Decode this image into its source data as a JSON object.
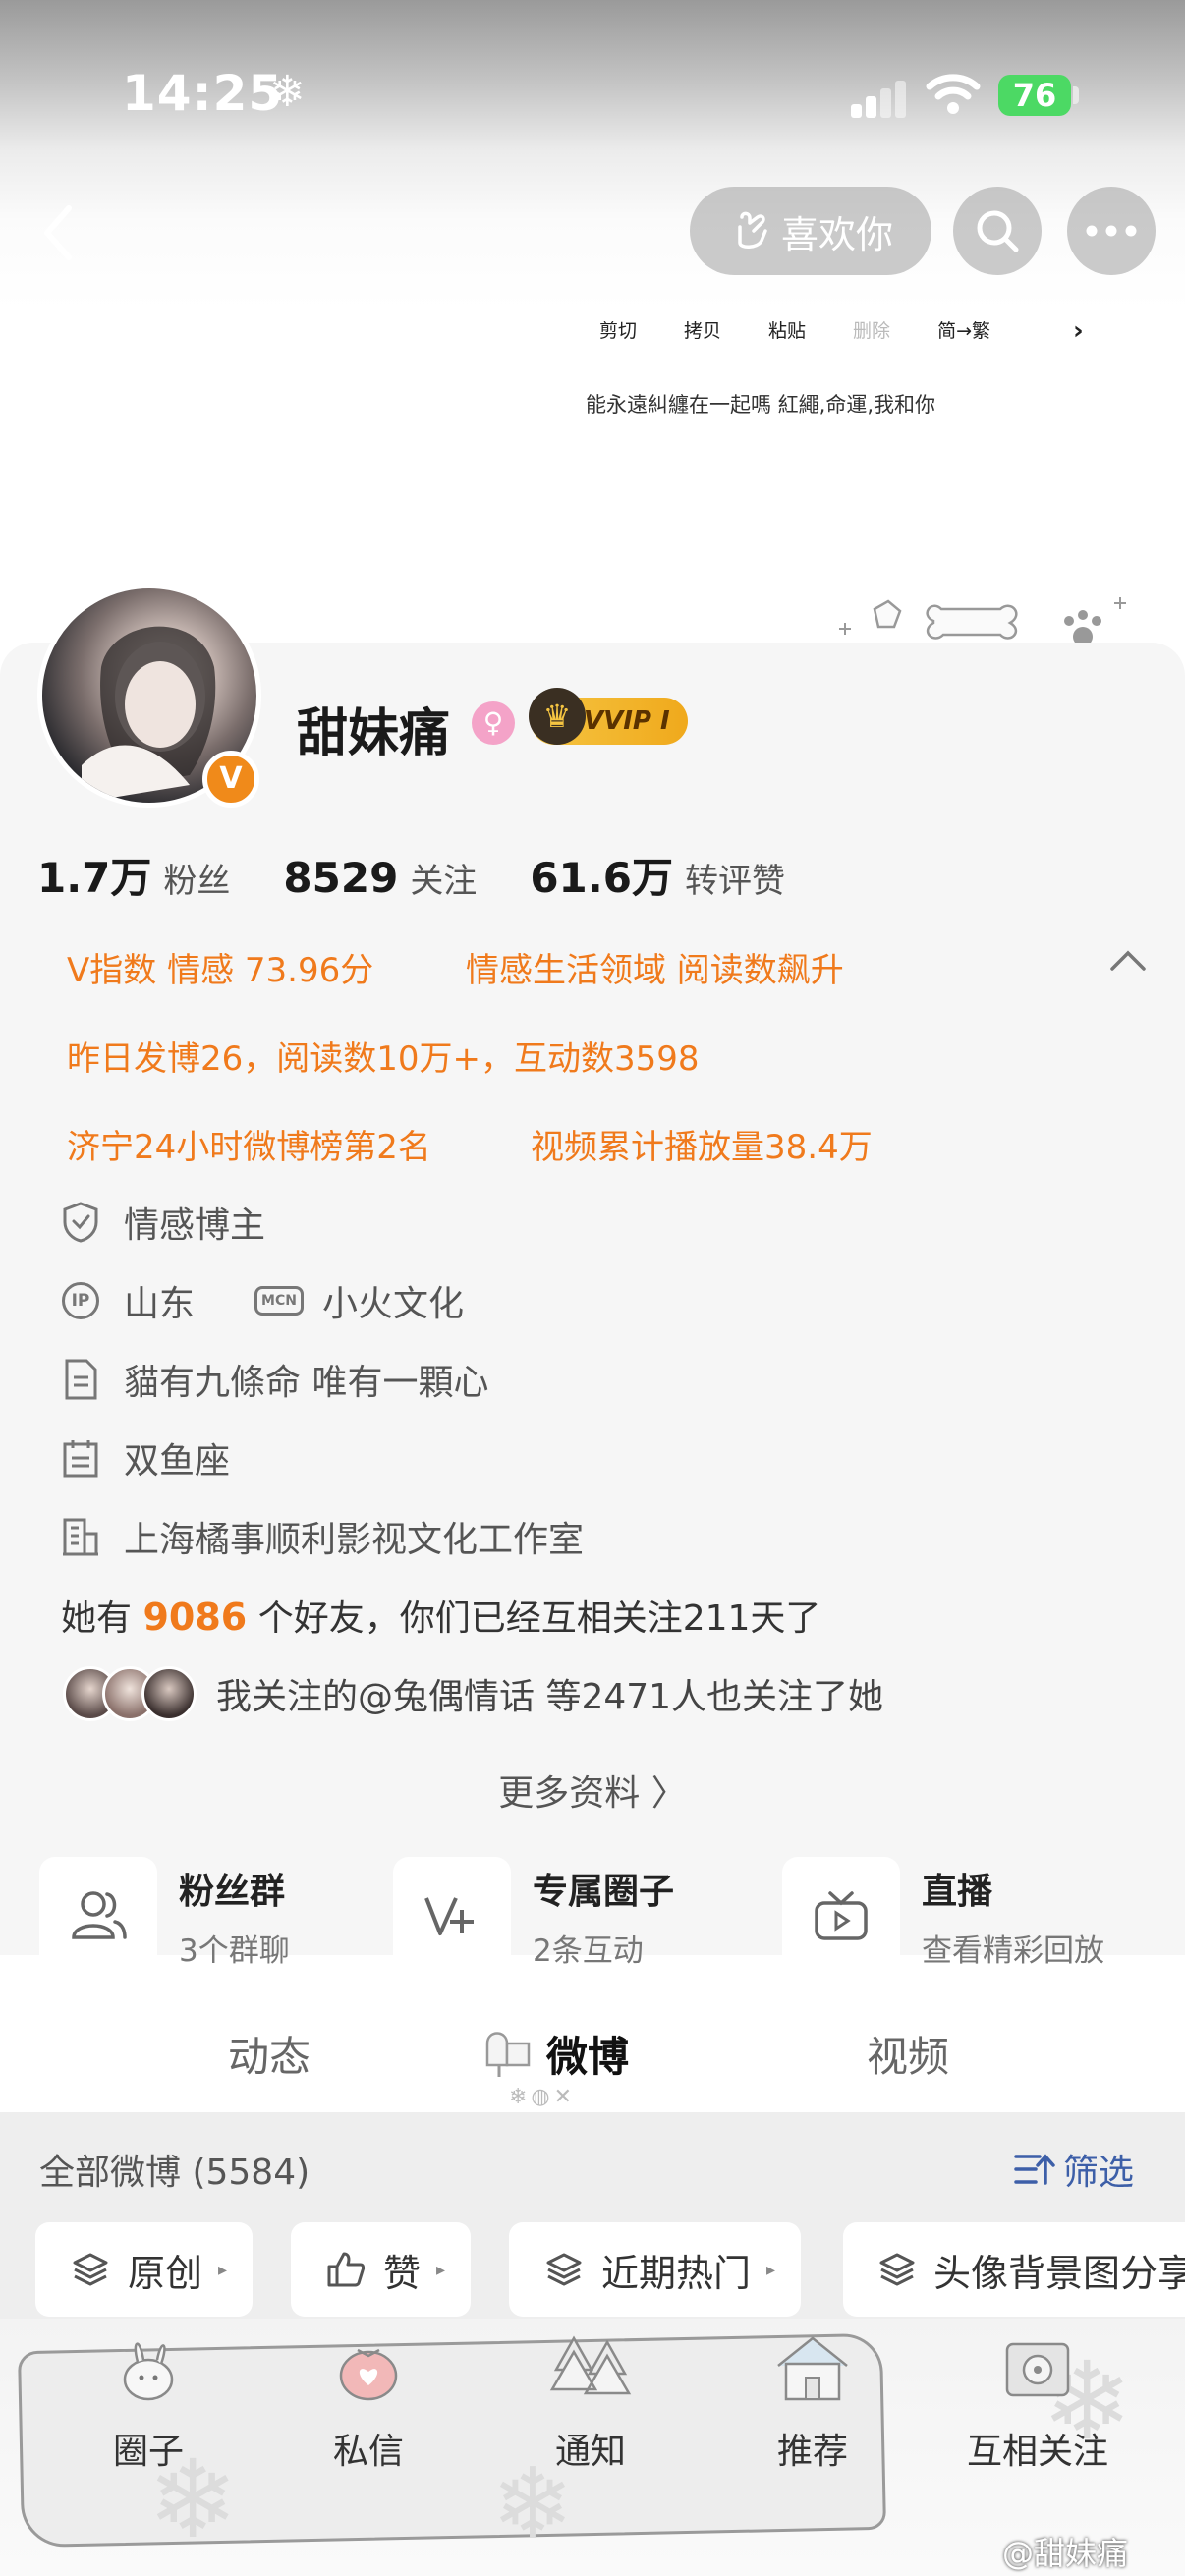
{
  "status": {
    "time": "14:25",
    "weather_glyph": "❄",
    "battery": "76"
  },
  "nav": {
    "like_label": "喜欢你"
  },
  "context_menu": {
    "items": [
      "剪切",
      "拷贝",
      "粘贴",
      "删除",
      "简→繁"
    ],
    "disabled_index": 3
  },
  "signature_line": "能永遠糾纏在一起嗎  紅繩,命運,我和你",
  "profile": {
    "name": "甜妹痛",
    "verified_badge": "V",
    "vip_label": "VVIP I"
  },
  "stats": [
    {
      "value": "1.7万",
      "label": "粉丝"
    },
    {
      "value": "8529",
      "label": "关注"
    },
    {
      "value": "61.6万",
      "label": "转评赞"
    }
  ],
  "highlights": {
    "v_index": "V指数 情感 73.96分",
    "domain": "情感生活领域 阅读数飙升",
    "yesterday": "昨日发博26，阅读数10万+，互动数3598",
    "rank": "济宁24小时微博榜第2名",
    "video": "视频累计播放量38.4万"
  },
  "details": {
    "category": "情感博主",
    "ip_badge": "IP",
    "ip_location": "山东",
    "mcn_badge": "MCN",
    "mcn_name": "小火文化",
    "bio": "貓有九條命  唯有一顆心",
    "zodiac": "双鱼座",
    "company": "上海橘事顺利影视文化工作室"
  },
  "friends": {
    "prefix": "她有",
    "count": "9086",
    "suffix": "个好友，你们已经互相关注211天了",
    "mutual_text": "我关注的@兔偶情话  等2471人也关注了她"
  },
  "more_info": "更多资料 〉",
  "features": [
    {
      "title": "粉丝群",
      "sub": "3个群聊"
    },
    {
      "title": "专属圈子",
      "sub": "2条互动"
    },
    {
      "title": "直播",
      "sub": "查看精彩回放"
    }
  ],
  "tabs": [
    "动态",
    "微博",
    "视频"
  ],
  "feed": {
    "all_label": "全部微博 (5584)",
    "filter_label": "筛选",
    "chips": [
      "原创",
      "赞",
      "近期热门",
      "头像背景图分享"
    ]
  },
  "bottom_nav": [
    "圈子",
    "私信",
    "通知",
    "推荐",
    "互相关注"
  ],
  "watermark": "@甜妹痛",
  "colors": {
    "accent_orange": "#f07a1c",
    "link_blue": "#3d5fa8",
    "battery_green": "#4cd964",
    "vip_gold": "#f5c542"
  }
}
